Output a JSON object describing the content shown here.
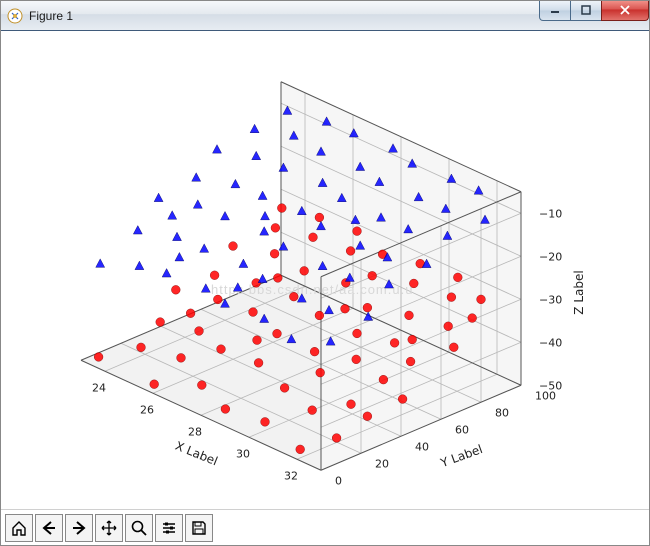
{
  "window": {
    "title": "Figure 1"
  },
  "watermark": "https   bbs.csdn.net/aa.com.u.u",
  "chart_data": {
    "type": "scatter3d",
    "xlabel": "X Label",
    "ylabel": "Y Label",
    "zlabel": "Z Label",
    "x_ticks": [
      24,
      26,
      28,
      30,
      32
    ],
    "y_ticks": [
      0,
      20,
      40,
      60,
      80,
      100
    ],
    "z_ticks": [
      -50,
      -40,
      -30,
      -20,
      -10
    ],
    "x_range": [
      23,
      33
    ],
    "y_range": [
      0,
      100
    ],
    "z_range": [
      -50,
      -5
    ],
    "series": [
      {
        "name": "red_circles",
        "marker": "o",
        "color": "#ff0000",
        "points": [
          {
            "x": 23.4,
            "y": 4,
            "z": -49
          },
          {
            "x": 25.8,
            "y": 3,
            "z": -49
          },
          {
            "x": 24.0,
            "y": 18,
            "z": -48
          },
          {
            "x": 25.5,
            "y": 20,
            "z": -47
          },
          {
            "x": 27.2,
            "y": 10,
            "z": -47
          },
          {
            "x": 28.6,
            "y": 5,
            "z": -48
          },
          {
            "x": 30.0,
            "y": 8,
            "z": -48
          },
          {
            "x": 31.8,
            "y": 4,
            "z": -49
          },
          {
            "x": 32.4,
            "y": 15,
            "z": -47
          },
          {
            "x": 23.8,
            "y": 30,
            "z": -45
          },
          {
            "x": 25.0,
            "y": 35,
            "z": -45
          },
          {
            "x": 26.5,
            "y": 28,
            "z": -44
          },
          {
            "x": 27.9,
            "y": 30,
            "z": -44
          },
          {
            "x": 29.4,
            "y": 25,
            "z": -45
          },
          {
            "x": 30.8,
            "y": 22,
            "z": -46
          },
          {
            "x": 31.5,
            "y": 33,
            "z": -45
          },
          {
            "x": 32.6,
            "y": 28,
            "z": -44
          },
          {
            "x": 23.2,
            "y": 45,
            "z": -42
          },
          {
            "x": 24.7,
            "y": 48,
            "z": -41
          },
          {
            "x": 26.0,
            "y": 50,
            "z": -41
          },
          {
            "x": 27.5,
            "y": 44,
            "z": -41
          },
          {
            "x": 28.9,
            "y": 46,
            "z": -42
          },
          {
            "x": 30.3,
            "y": 50,
            "z": -41
          },
          {
            "x": 31.6,
            "y": 48,
            "z": -42
          },
          {
            "x": 32.9,
            "y": 42,
            "z": -42
          },
          {
            "x": 23.9,
            "y": 56,
            "z": -39
          },
          {
            "x": 25.3,
            "y": 60,
            "z": -38
          },
          {
            "x": 26.7,
            "y": 62,
            "z": -38
          },
          {
            "x": 28.1,
            "y": 58,
            "z": -38
          },
          {
            "x": 29.5,
            "y": 60,
            "z": -39
          },
          {
            "x": 30.9,
            "y": 62,
            "z": -38
          },
          {
            "x": 31.9,
            "y": 58,
            "z": -39
          },
          {
            "x": 23.5,
            "y": 70,
            "z": -36
          },
          {
            "x": 24.9,
            "y": 74,
            "z": -35
          },
          {
            "x": 26.3,
            "y": 72,
            "z": -35
          },
          {
            "x": 27.7,
            "y": 76,
            "z": -35
          },
          {
            "x": 29.1,
            "y": 70,
            "z": -36
          },
          {
            "x": 30.5,
            "y": 74,
            "z": -35
          },
          {
            "x": 31.8,
            "y": 78,
            "z": -35
          },
          {
            "x": 32.7,
            "y": 70,
            "z": -36
          },
          {
            "x": 24.1,
            "y": 84,
            "z": -33
          },
          {
            "x": 25.5,
            "y": 86,
            "z": -32
          },
          {
            "x": 26.9,
            "y": 88,
            "z": -32
          },
          {
            "x": 28.3,
            "y": 82,
            "z": -33
          },
          {
            "x": 29.7,
            "y": 86,
            "z": -32
          },
          {
            "x": 31.1,
            "y": 88,
            "z": -32
          },
          {
            "x": 32.3,
            "y": 84,
            "z": -33
          },
          {
            "x": 23.7,
            "y": 92,
            "z": -31
          },
          {
            "x": 25.1,
            "y": 94,
            "z": -30
          },
          {
            "x": 26.5,
            "y": 96,
            "z": -30
          },
          {
            "x": 27.9,
            "y": 92,
            "z": -31
          },
          {
            "x": 29.3,
            "y": 94,
            "z": -30
          },
          {
            "x": 30.7,
            "y": 96,
            "z": -30
          },
          {
            "x": 32.0,
            "y": 92,
            "z": -31
          },
          {
            "x": 24.4,
            "y": 38,
            "z": -43
          },
          {
            "x": 27.0,
            "y": 40,
            "z": -43
          },
          {
            "x": 29.8,
            "y": 38,
            "z": -43
          },
          {
            "x": 25.7,
            "y": 66,
            "z": -37
          },
          {
            "x": 28.5,
            "y": 66,
            "z": -37
          },
          {
            "x": 31.3,
            "y": 66,
            "z": -37
          }
        ]
      },
      {
        "name": "blue_triangles",
        "marker": "^",
        "color": "#0000ff",
        "points": [
          {
            "x": 23.3,
            "y": 6,
            "z": -28
          },
          {
            "x": 24.6,
            "y": 10,
            "z": -26
          },
          {
            "x": 25.9,
            "y": 8,
            "z": -24
          },
          {
            "x": 27.2,
            "y": 12,
            "z": -25
          },
          {
            "x": 28.5,
            "y": 6,
            "z": -24
          },
          {
            "x": 29.8,
            "y": 10,
            "z": -25
          },
          {
            "x": 31.1,
            "y": 8,
            "z": -26
          },
          {
            "x": 32.4,
            "y": 12,
            "z": -24
          },
          {
            "x": 23.7,
            "y": 20,
            "z": -22
          },
          {
            "x": 25.0,
            "y": 24,
            "z": -21
          },
          {
            "x": 26.3,
            "y": 22,
            "z": -20
          },
          {
            "x": 27.6,
            "y": 26,
            "z": -21
          },
          {
            "x": 28.9,
            "y": 20,
            "z": -20
          },
          {
            "x": 30.2,
            "y": 24,
            "z": -22
          },
          {
            "x": 31.5,
            "y": 22,
            "z": -21
          },
          {
            "x": 32.8,
            "y": 26,
            "z": -20
          },
          {
            "x": 23.4,
            "y": 34,
            "z": -18
          },
          {
            "x": 24.7,
            "y": 38,
            "z": -17
          },
          {
            "x": 26.0,
            "y": 36,
            "z": -16
          },
          {
            "x": 27.3,
            "y": 40,
            "z": -17
          },
          {
            "x": 28.6,
            "y": 34,
            "z": -16
          },
          {
            "x": 29.9,
            "y": 38,
            "z": -18
          },
          {
            "x": 31.2,
            "y": 36,
            "z": -17
          },
          {
            "x": 32.5,
            "y": 40,
            "z": -16
          },
          {
            "x": 23.8,
            "y": 48,
            "z": -15
          },
          {
            "x": 25.1,
            "y": 52,
            "z": -14
          },
          {
            "x": 26.4,
            "y": 50,
            "z": -13
          },
          {
            "x": 27.7,
            "y": 54,
            "z": -14
          },
          {
            "x": 29.0,
            "y": 48,
            "z": -13
          },
          {
            "x": 30.3,
            "y": 52,
            "z": -15
          },
          {
            "x": 31.6,
            "y": 50,
            "z": -14
          },
          {
            "x": 32.9,
            "y": 54,
            "z": -13
          },
          {
            "x": 23.5,
            "y": 62,
            "z": -12
          },
          {
            "x": 24.8,
            "y": 66,
            "z": -11
          },
          {
            "x": 26.1,
            "y": 64,
            "z": -10
          },
          {
            "x": 27.4,
            "y": 68,
            "z": -11
          },
          {
            "x": 28.7,
            "y": 62,
            "z": -10
          },
          {
            "x": 30.0,
            "y": 66,
            "z": -12
          },
          {
            "x": 31.3,
            "y": 64,
            "z": -11
          },
          {
            "x": 32.6,
            "y": 68,
            "z": -10
          },
          {
            "x": 23.9,
            "y": 76,
            "z": -9
          },
          {
            "x": 25.2,
            "y": 80,
            "z": -8
          },
          {
            "x": 26.5,
            "y": 78,
            "z": -8
          },
          {
            "x": 27.8,
            "y": 82,
            "z": -9
          },
          {
            "x": 29.1,
            "y": 76,
            "z": -8
          },
          {
            "x": 30.4,
            "y": 80,
            "z": -9
          },
          {
            "x": 31.7,
            "y": 78,
            "z": -8
          },
          {
            "x": 33.0,
            "y": 82,
            "z": -8
          },
          {
            "x": 24.1,
            "y": 90,
            "z": -7
          },
          {
            "x": 25.4,
            "y": 94,
            "z": -7
          },
          {
            "x": 26.7,
            "y": 92,
            "z": -6
          },
          {
            "x": 28.0,
            "y": 96,
            "z": -7
          },
          {
            "x": 29.3,
            "y": 90,
            "z": -6
          },
          {
            "x": 30.6,
            "y": 94,
            "z": -7
          },
          {
            "x": 31.9,
            "y": 92,
            "z": -6
          },
          {
            "x": 24.3,
            "y": 30,
            "z": -19
          },
          {
            "x": 27.0,
            "y": 44,
            "z": -15
          },
          {
            "x": 29.6,
            "y": 58,
            "z": -12
          },
          {
            "x": 25.6,
            "y": 18,
            "z": -23
          },
          {
            "x": 28.2,
            "y": 16,
            "z": -23
          }
        ]
      }
    ]
  },
  "toolbar": {
    "buttons": [
      "home",
      "back",
      "forward",
      "pan",
      "zoom",
      "configure",
      "save"
    ]
  }
}
